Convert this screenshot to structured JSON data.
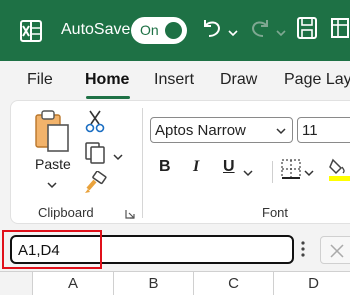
{
  "titlebar": {
    "autosave_label": "AutoSave",
    "toggle_state": "On"
  },
  "tabs": [
    {
      "label": "File"
    },
    {
      "label": "Home",
      "active": true
    },
    {
      "label": "Insert"
    },
    {
      "label": "Draw"
    },
    {
      "label": "Page Lay"
    }
  ],
  "clipboard": {
    "paste_label": "Paste",
    "group_label": "Clipboard"
  },
  "font": {
    "font_name": "Aptos Narrow",
    "font_size": "11",
    "bold": "B",
    "italic": "I",
    "underline": "U",
    "group_label": "Font"
  },
  "formula_bar": {
    "name_box_value": "A1,D4"
  },
  "columns": [
    "A",
    "B",
    "C",
    "D"
  ],
  "colors": {
    "brand": "#1e7145",
    "highlight": "#e0101a",
    "fill_color": "#ffff00"
  }
}
